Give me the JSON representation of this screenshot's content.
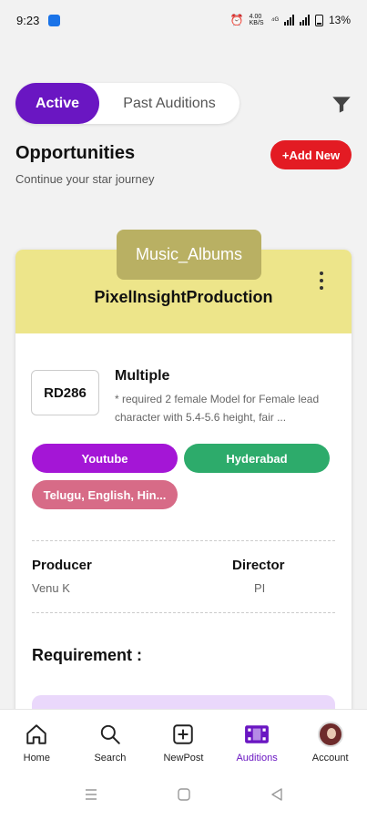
{
  "status_bar": {
    "time": "9:23",
    "net_speed": "4.00 KB/S",
    "battery": "13%"
  },
  "tabs": {
    "active": "Active",
    "past": "Past Auditions"
  },
  "header": {
    "title": "Opportunities",
    "subtitle": "Continue your star journey",
    "add_button": "+Add New"
  },
  "card": {
    "category": "Music_Albums",
    "company": "PixelInsightProduction",
    "code": "RD286",
    "role_title": "Multiple",
    "role_description": "* required 2 female Model for Female lead character with 5.4-5.6 height, fair ...",
    "chips": {
      "platform": "Youtube",
      "location": "Hyderabad",
      "languages": "Telugu, English, Hin..."
    },
    "producer_label": "Producer",
    "producer_name": "Venu K",
    "director_label": "Director",
    "director_name": "PI",
    "requirement_title": "Requirement :"
  },
  "bottom_nav": {
    "items": [
      {
        "label": "Home",
        "icon": "home-icon"
      },
      {
        "label": "Search",
        "icon": "search-icon"
      },
      {
        "label": "NewPost",
        "icon": "plus-square-icon"
      },
      {
        "label": "Auditions",
        "icon": "film-icon",
        "active": true
      },
      {
        "label": "Account",
        "icon": "avatar"
      }
    ]
  },
  "colors": {
    "accent_purple": "#6a16c2",
    "add_red": "#e31b23",
    "card_header": "#ede58a",
    "chip_platform": "#a416d6",
    "chip_location": "#2dab6b",
    "chip_language": "#d76b87"
  }
}
